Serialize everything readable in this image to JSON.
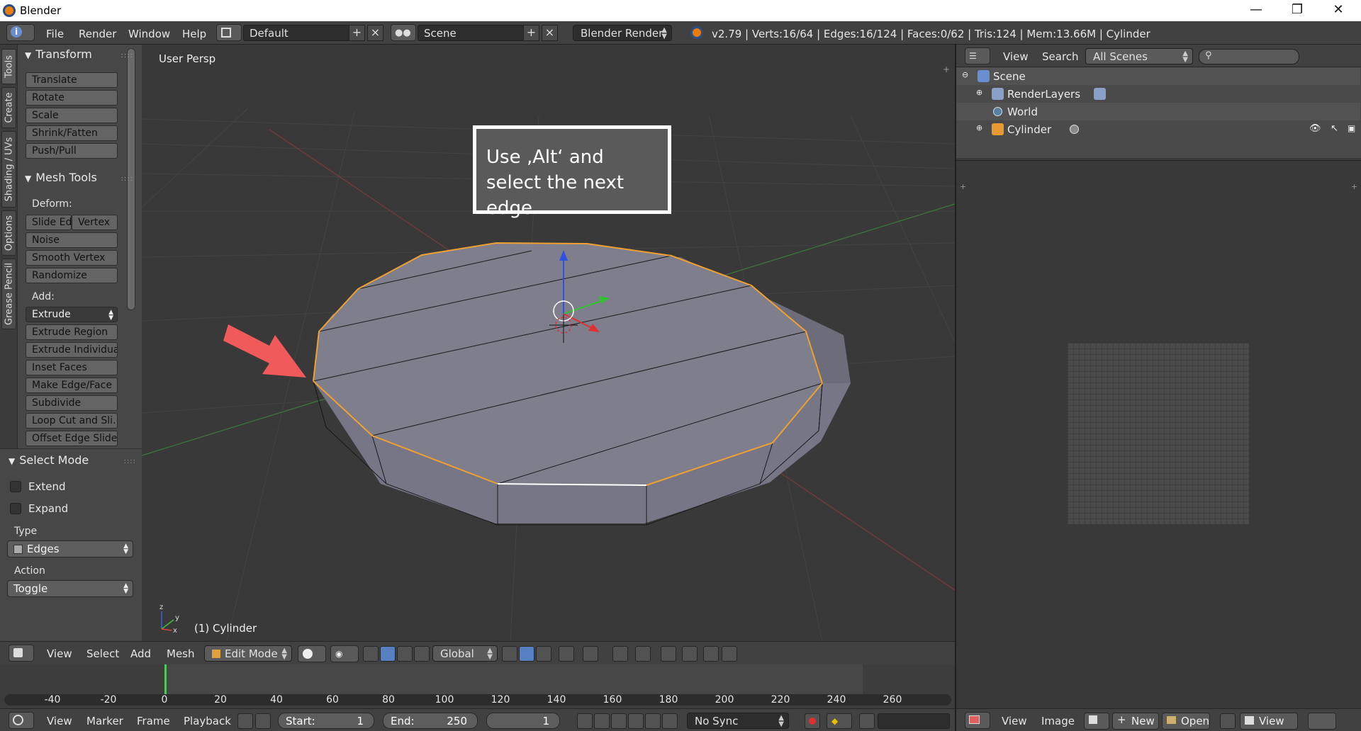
{
  "window": {
    "title": "Blender",
    "controls": {
      "minimize": "—",
      "maximize": "❐",
      "close": "✕"
    }
  },
  "infobar": {
    "menus": [
      "File",
      "Render",
      "Window",
      "Help"
    ],
    "screen_layout": "Default",
    "scene": "Scene",
    "engine": "Blender Render",
    "stats": "v2.79 | Verts:16/64 | Edges:16/124 | Faces:0/62 | Tris:124 | Mem:13.66M | Cylinder"
  },
  "vtabs": [
    "Tools",
    "Create",
    "Shading / UVs",
    "Options",
    "Grease Pencil"
  ],
  "toolshelf": {
    "transform": {
      "title": "Transform",
      "buttons": [
        "Translate",
        "Rotate",
        "Scale",
        "Shrink/Fatten",
        "Push/Pull"
      ]
    },
    "mesh_tools": {
      "title": "Mesh Tools",
      "deform_label": "Deform:",
      "deform_pair": [
        "Slide Ed",
        "Vertex"
      ],
      "deform_buttons": [
        "Noise",
        "Smooth Vertex",
        "Randomize"
      ],
      "add_label": "Add:",
      "extrude": "Extrude",
      "add_buttons": [
        "Extrude Region",
        "Extrude Individual",
        "Inset Faces",
        "Make Edge/Face",
        "Subdivide",
        "Loop Cut and Sli...",
        "Offset Edge Slide"
      ]
    },
    "select_mode": {
      "title": "Select Mode",
      "extend": "Extend",
      "expand": "Expand",
      "type_label": "Type",
      "type_value": "Edges",
      "action_label": "Action",
      "action_value": "Toggle"
    }
  },
  "viewport": {
    "view_label": "User Persp",
    "object_label": "(1) Cylinder",
    "callout_text": "Use ‚Alt‘ and select the next edge",
    "axis_x": "x",
    "axis_y": "y",
    "axis_z": "z",
    "colors": {
      "selected_edge": "#f0a030",
      "arrow": "#f05a5a",
      "mesh_face": "#7e7e8c"
    }
  },
  "view_header": {
    "menus": [
      "View",
      "Select",
      "Add",
      "Mesh"
    ],
    "mode": "Edit Mode",
    "orientation": "Global"
  },
  "timeline": {
    "ticks": [
      -40,
      -20,
      0,
      20,
      40,
      60,
      80,
      100,
      120,
      140,
      160,
      180,
      200,
      220,
      240,
      260
    ],
    "menus": [
      "View",
      "Marker",
      "Frame",
      "Playback"
    ],
    "start_label": "Start:",
    "start_value": "1",
    "end_label": "End:",
    "end_value": "250",
    "current_frame": "1",
    "sync": "No Sync"
  },
  "outliner": {
    "view": "View",
    "search": "Search",
    "filter": "All Scenes",
    "rows": [
      {
        "name": "Scene"
      },
      {
        "name": "RenderLayers"
      },
      {
        "name": "World"
      },
      {
        "name": "Cylinder"
      }
    ]
  },
  "image_editor": {
    "menus": [
      "View",
      "Image"
    ],
    "new": "New",
    "open": "Open",
    "view": "View"
  }
}
